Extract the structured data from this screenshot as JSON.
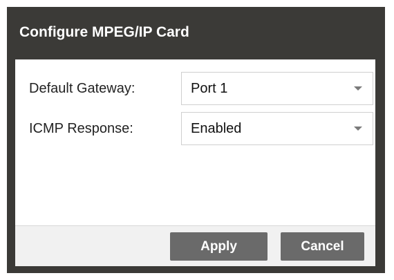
{
  "dialog": {
    "title": "Configure MPEG/IP Card"
  },
  "fields": {
    "default_gateway": {
      "label": "Default Gateway:",
      "value": "Port 1"
    },
    "icmp_response": {
      "label": "ICMP Response:",
      "value": "Enabled"
    }
  },
  "footer": {
    "apply_label": "Apply",
    "cancel_label": "Cancel"
  },
  "icons": {
    "dropdown": "chevron-down-icon"
  },
  "colors": {
    "titlebar": "#3b3a37",
    "button": "#6a6a6a",
    "footer": "#f1f1f1"
  }
}
